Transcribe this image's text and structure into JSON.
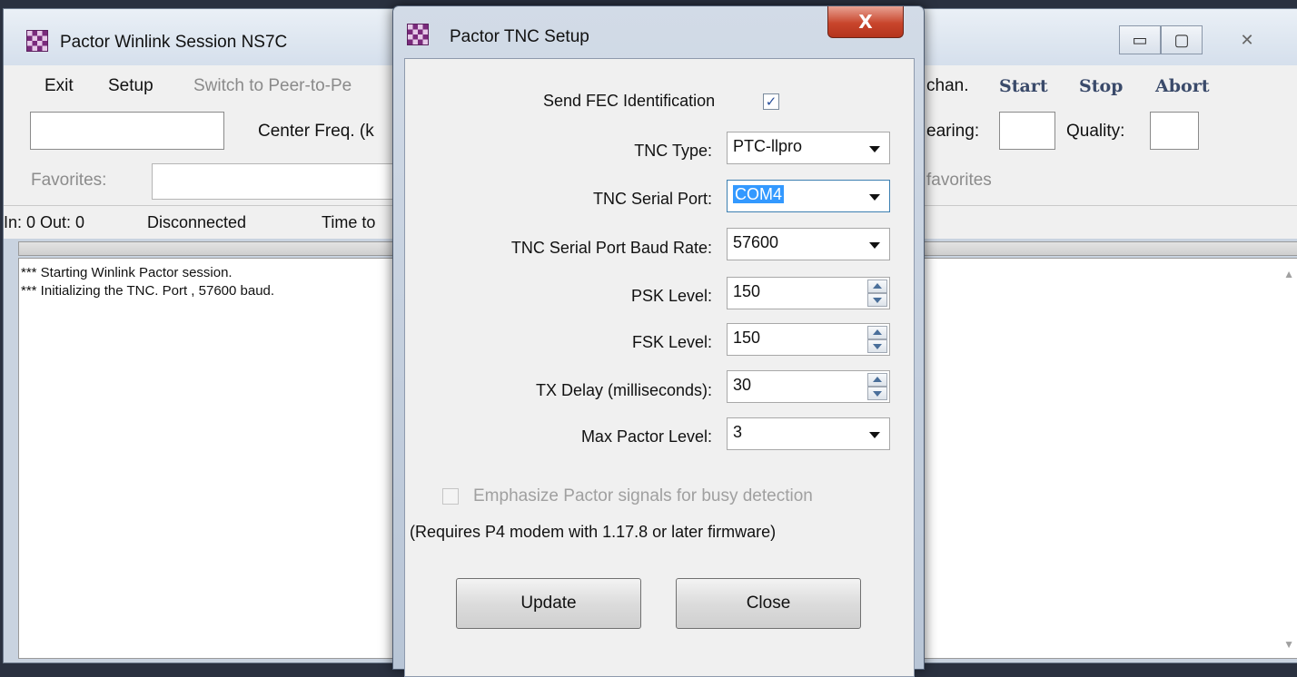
{
  "main_window": {
    "title": "Pactor Winlink Session NS7C",
    "controls": {
      "minimize": "▭",
      "maximize": "▢",
      "close": "✕"
    },
    "menu": {
      "exit": "Exit",
      "setup": "Setup",
      "switch": "Switch to Peer-to-Pe",
      "chan": "chan.",
      "start": "Start",
      "stop": "Stop",
      "abort": "Abort"
    },
    "center_freq_label": "Center Freq. (k",
    "bearing_label": "earing:",
    "quality_label": "Quality:",
    "favorites_label": "Favorites:",
    "favorites_right": "favorites",
    "status": {
      "in_out": "In: 0  Out: 0",
      "state": "Disconnected",
      "time_label": "Time to"
    },
    "log_lines": [
      "*** Starting Winlink Pactor session.",
      "*** Initializing the  TNC.  Port , 57600 baud."
    ]
  },
  "dialog": {
    "title": "Pactor TNC Setup",
    "close_label": "X",
    "send_fec": {
      "label": "Send FEC Identification",
      "checked": true,
      "mark": "✓"
    },
    "tnc_type": {
      "label": "TNC Type:",
      "value": "PTC-llpro"
    },
    "serial_port": {
      "label": "TNC Serial Port:",
      "value": "COM4"
    },
    "baud_rate": {
      "label": "TNC Serial Port Baud Rate:",
      "value": "57600"
    },
    "psk_level": {
      "label": "PSK Level:",
      "value": "150"
    },
    "fsk_level": {
      "label": "FSK Level:",
      "value": "150"
    },
    "tx_delay": {
      "label": "TX Delay (milliseconds):",
      "value": "30"
    },
    "max_pactor": {
      "label": "Max Pactor Level:",
      "value": "3"
    },
    "emphasize": {
      "label": "Emphasize Pactor signals for busy detection",
      "checked": false
    },
    "requires_note": "(Requires P4 modem with 1.17.8 or later firmware)",
    "update_button": "Update",
    "close_button": "Close"
  }
}
